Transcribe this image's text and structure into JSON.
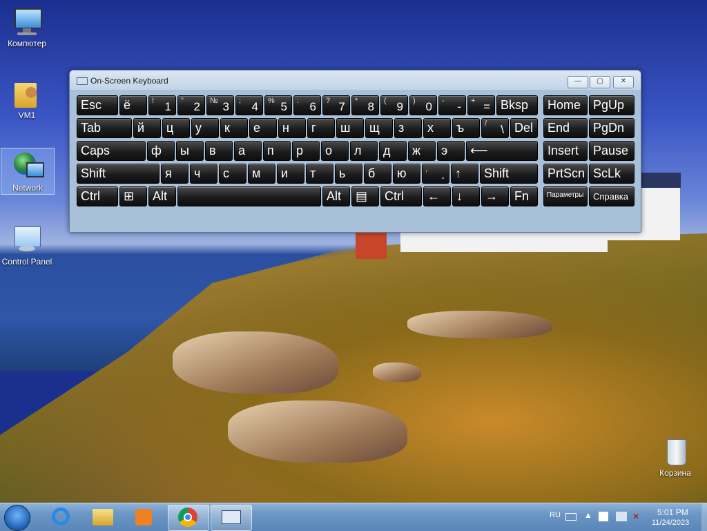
{
  "desktop": {
    "icons": [
      {
        "label": "Компютер"
      },
      {
        "label": "VM1"
      },
      {
        "label": "Network"
      },
      {
        "label": "Control Panel"
      },
      {
        "label": "Корзина"
      }
    ]
  },
  "osk": {
    "title": "On-Screen Keyboard",
    "controls": {
      "minimize": "—",
      "restore": "▢",
      "close": "✕"
    },
    "rows": [
      [
        {
          "m": "Esc"
        },
        {
          "m": "ё"
        },
        {
          "s": "!",
          "m": "1"
        },
        {
          "s": "\"",
          "m": "2"
        },
        {
          "s": "№",
          "m": "3"
        },
        {
          "s": ";",
          "m": "4"
        },
        {
          "s": "%",
          "m": "5"
        },
        {
          "s": ":",
          "m": "6"
        },
        {
          "s": "?",
          "m": "7"
        },
        {
          "s": "*",
          "m": "8"
        },
        {
          "s": "(",
          "m": "9"
        },
        {
          "s": ")",
          "m": "0"
        },
        {
          "s": "-",
          "m": "-"
        },
        {
          "s": "+",
          "m": "="
        },
        {
          "m": "Bksp"
        },
        {
          "m": "Home"
        },
        {
          "m": "PgUp"
        }
      ],
      [
        {
          "m": "Tab"
        },
        {
          "m": "й"
        },
        {
          "m": "ц"
        },
        {
          "m": "у"
        },
        {
          "m": "к"
        },
        {
          "m": "е"
        },
        {
          "m": "н"
        },
        {
          "m": "г"
        },
        {
          "m": "ш"
        },
        {
          "m": "щ"
        },
        {
          "m": "з"
        },
        {
          "m": "х"
        },
        {
          "m": "ъ"
        },
        {
          "s": "/",
          "m": "\\"
        },
        {
          "m": "Del"
        },
        {
          "m": "End"
        },
        {
          "m": "PgDn"
        }
      ],
      [
        {
          "m": "Caps"
        },
        {
          "m": "ф"
        },
        {
          "m": "ы"
        },
        {
          "m": "в"
        },
        {
          "m": "а"
        },
        {
          "m": "п"
        },
        {
          "m": "р"
        },
        {
          "m": "о"
        },
        {
          "m": "л"
        },
        {
          "m": "д"
        },
        {
          "m": "ж"
        },
        {
          "m": "э"
        },
        {
          "m": "⟵"
        },
        {
          "m": "Insert"
        },
        {
          "m": "Pause"
        }
      ],
      [
        {
          "m": "Shift"
        },
        {
          "m": "я"
        },
        {
          "m": "ч"
        },
        {
          "m": "с"
        },
        {
          "m": "м"
        },
        {
          "m": "и"
        },
        {
          "m": "т"
        },
        {
          "m": "ь"
        },
        {
          "m": "б"
        },
        {
          "m": "ю"
        },
        {
          "s": ",",
          "m": "."
        },
        {
          "m": "↑"
        },
        {
          "m": "Shift"
        },
        {
          "m": "PrtScn"
        },
        {
          "m": "ScLk"
        }
      ],
      [
        {
          "m": "Ctrl"
        },
        {
          "m": "⊞"
        },
        {
          "m": "Alt"
        },
        {
          "m": ""
        },
        {
          "m": "Alt"
        },
        {
          "m": "▤"
        },
        {
          "m": "Ctrl"
        },
        {
          "m": "←"
        },
        {
          "m": "↓"
        },
        {
          "m": "→"
        },
        {
          "m": "Fn"
        },
        {
          "m": "Параметры"
        },
        {
          "m": "Справка"
        }
      ]
    ]
  },
  "taskbar": {
    "lang": "RU",
    "time": "5:01 PM",
    "date": "11/24/2023",
    "apps": [
      "start",
      "ie",
      "explorer",
      "media-player",
      "chrome",
      "on-screen-keyboard"
    ]
  }
}
